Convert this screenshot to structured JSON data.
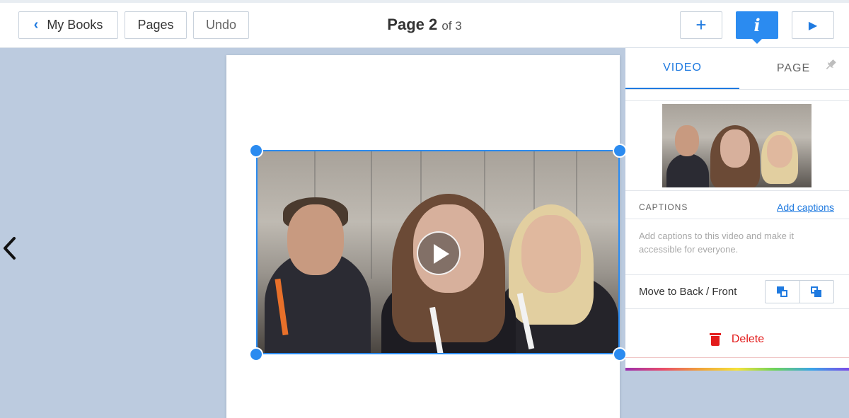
{
  "toolbar": {
    "back_label": "My Books",
    "pages_label": "Pages",
    "undo_label": "Undo",
    "page_prefix": "Page 2",
    "page_suffix": "of 3",
    "add_symbol": "+",
    "info_symbol": "i",
    "play_symbol": "▶"
  },
  "icons": {
    "back": "chevron-left-icon",
    "prev_page": "chevron-left-icon",
    "play_video": "play-icon",
    "pin": "pin-icon",
    "move_back": "send-to-back-icon",
    "move_front": "bring-to-front-icon",
    "delete": "trash-icon"
  },
  "canvas": {
    "prev_symbol": "‹"
  },
  "panel": {
    "tabs": [
      {
        "label": "VIDEO",
        "active": true
      },
      {
        "label": "PAGE",
        "active": false
      }
    ],
    "captions_label": "CAPTIONS",
    "add_captions_label": "Add captions",
    "captions_description": "Add captions to this video and make it accessible for everyone.",
    "move_label": "Move to Back / Front",
    "delete_label": "Delete"
  },
  "colors": {
    "accent": "#2b8bf0",
    "delete": "#e31b1b",
    "background": "#bccbdf"
  }
}
